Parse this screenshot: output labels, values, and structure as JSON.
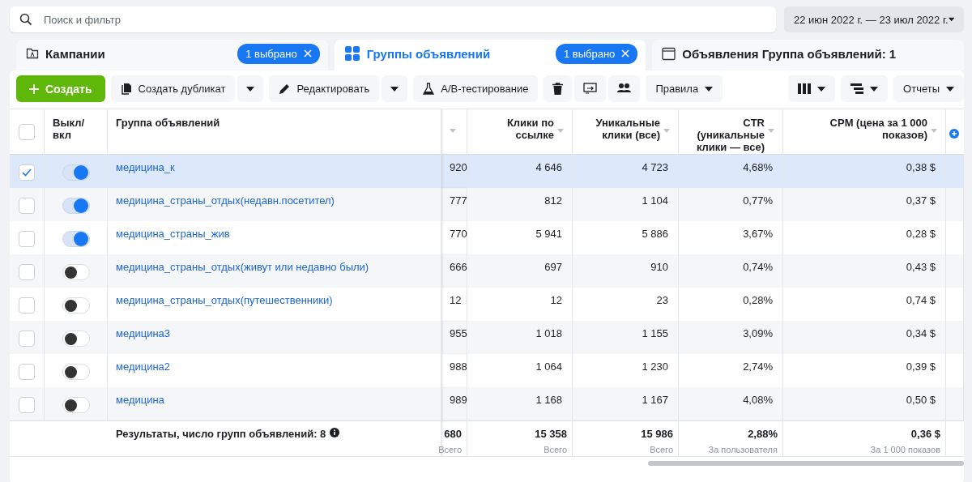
{
  "search": {
    "placeholder": "Поиск и фильтр"
  },
  "date_range": "22 июн 2022 г. — 23 июл 2022 г.",
  "tabs": [
    {
      "kind": "campaigns",
      "label": "Кампании",
      "badge": "1 выбрано",
      "selected": false
    },
    {
      "kind": "adsets",
      "label": "Группы объявлений",
      "badge": "1 выбрано",
      "selected": true
    },
    {
      "kind": "ads",
      "label": "Объявления Группа объявлений: 1",
      "selected": false
    }
  ],
  "toolbar": {
    "create": "Создать",
    "duplicate": "Создать дубликат",
    "edit": "Редактировать",
    "ab_test": "A/B-тестирование",
    "rules": "Правила",
    "reports": "Отчеты"
  },
  "table": {
    "header_checkbox": {
      "checked": false
    },
    "columns": [
      "Выкл/вкл",
      "Группа объявлений",
      "Клики по ссылке",
      "Уникальные клики (все)",
      "CTR (уникальные клики — все)",
      "CPM (цена за 1 000 показов)"
    ],
    "rows": [
      {
        "selected": true,
        "checked": true,
        "on": true,
        "name": "медицина_к",
        "column_3": "920",
        "link_clicks": "4 646",
        "unique_clicks": "4 723",
        "ctr": "4,68%",
        "cpm": "0,38 $"
      },
      {
        "selected": false,
        "checked": false,
        "on": true,
        "name": "медицина_страны_отдых(недавн.посетител)",
        "column_3": "777",
        "link_clicks": "812",
        "unique_clicks": "1 104",
        "ctr": "0,77%",
        "cpm": "0,37 $"
      },
      {
        "selected": false,
        "checked": false,
        "on": true,
        "name": "медицина_страны_жив",
        "column_3": "770",
        "link_clicks": "5 941",
        "unique_clicks": "5 886",
        "ctr": "3,67%",
        "cpm": "0,28 $"
      },
      {
        "selected": false,
        "checked": false,
        "on": false,
        "name": "медицина_страны_отдых(живут или недавно были)",
        "column_3": "666",
        "link_clicks": "697",
        "unique_clicks": "910",
        "ctr": "0,74%",
        "cpm": "0,43 $"
      },
      {
        "selected": false,
        "checked": false,
        "on": false,
        "name": "медицина_страны_отдых(путешественники)",
        "column_3": "12",
        "link_clicks": "12",
        "unique_clicks": "23",
        "ctr": "0,28%",
        "cpm": "0,74 $"
      },
      {
        "selected": false,
        "checked": false,
        "on": false,
        "name": "медицина3",
        "column_3": "955",
        "link_clicks": "1 018",
        "unique_clicks": "1 155",
        "ctr": "3,09%",
        "cpm": "0,34 $"
      },
      {
        "selected": false,
        "checked": false,
        "on": false,
        "name": "медицина2",
        "column_3": "988",
        "link_clicks": "1 064",
        "unique_clicks": "1 230",
        "ctr": "2,74%",
        "cpm": "0,39 $"
      },
      {
        "selected": false,
        "checked": false,
        "on": false,
        "name": "медицина",
        "column_3": "989",
        "link_clicks": "1 168",
        "unique_clicks": "1 167",
        "ctr": "4,08%",
        "cpm": "0,50 $"
      }
    ],
    "totals": {
      "label": "Результаты, число групп объявлений: 8",
      "values": [
        {
          "value": "680",
          "note": "Всего"
        },
        {
          "value": "15 358",
          "note": "Всего"
        },
        {
          "value": "15 986",
          "note": "Всего"
        },
        {
          "value": "2,88%",
          "note": "За пользователя"
        },
        {
          "value": "0,36 $",
          "note": "За 1 000 показов"
        }
      ]
    }
  }
}
